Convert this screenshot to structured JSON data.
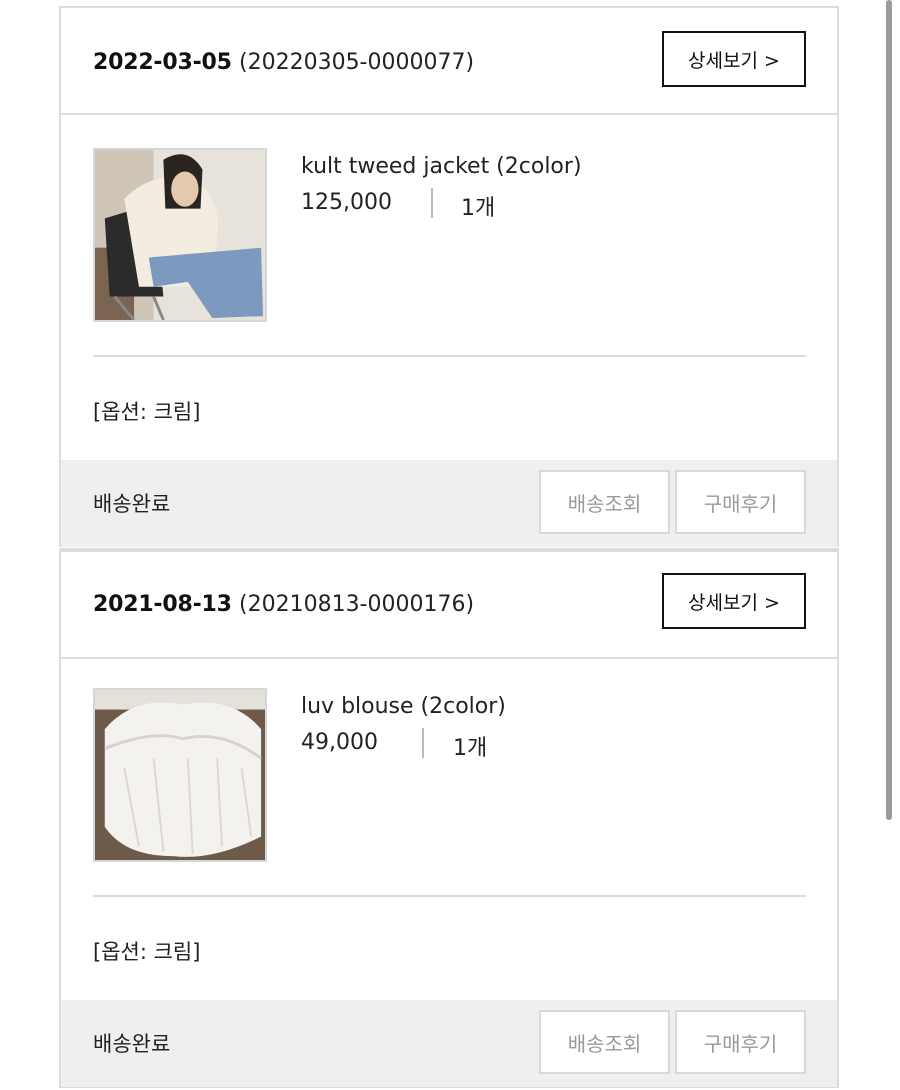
{
  "orders": [
    {
      "date": "2022-03-05",
      "order_no": "(20220305-0000077)",
      "detail_label": "상세보기 >",
      "product": {
        "name": "kult tweed jacket (2color)",
        "price": "125,000",
        "qty": "1개",
        "image_icon": "tweed-jacket-photo"
      },
      "option": "[옵션: 크림]",
      "status": "배송완료",
      "track_label": "배송조회",
      "review_label": "구매후기"
    },
    {
      "date": "2021-08-13",
      "order_no": "(20210813-0000176)",
      "detail_label": "상세보기 >",
      "product": {
        "name": "luv blouse (2color)",
        "price": "49,000",
        "qty": "1개",
        "image_icon": "white-blouse-photo"
      },
      "option": "[옵션: 크림]",
      "status": "배송완료",
      "track_label": "배송조회",
      "review_label": "구매후기"
    }
  ]
}
